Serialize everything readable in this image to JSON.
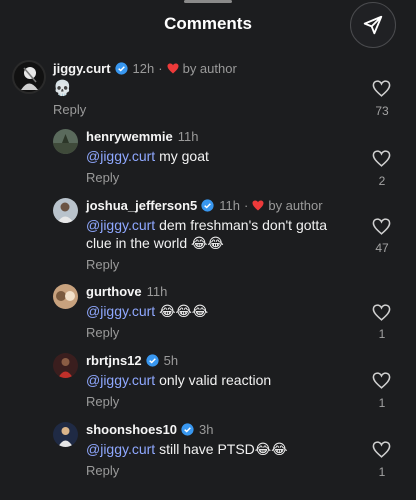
{
  "header": {
    "title": "Comments"
  },
  "comments": [
    {
      "username": "jiggy.curt",
      "verified": true,
      "time": "12h",
      "liked_by_author": true,
      "by_author": "by author",
      "mention": "",
      "text": "💀",
      "text2": "",
      "reply_label": "Reply",
      "likes": "73"
    },
    {
      "username": "henrywemmie",
      "verified": false,
      "time": "11h",
      "liked_by_author": false,
      "by_author": "",
      "mention": "@jiggy.curt",
      "text": " my goat",
      "text2": "",
      "reply_label": "Reply",
      "likes": "2"
    },
    {
      "username": "joshua_jefferson5",
      "verified": true,
      "time": "11h",
      "liked_by_author": true,
      "by_author": "by author",
      "mention": "@jiggy.curt",
      "text": " dem freshman's don't gotta",
      "text2": "clue in the world 😂😂",
      "reply_label": "Reply",
      "likes": "47"
    },
    {
      "username": "gurthove",
      "verified": false,
      "time": "11h",
      "liked_by_author": false,
      "by_author": "",
      "mention": "@jiggy.curt",
      "text": " 😂😂😂",
      "text2": "",
      "reply_label": "Reply",
      "likes": "1"
    },
    {
      "username": "rbrtjns12",
      "verified": true,
      "time": "5h",
      "liked_by_author": false,
      "by_author": "",
      "mention": "@jiggy.curt",
      "text": " only valid reaction",
      "text2": "",
      "reply_label": "Reply",
      "likes": "1"
    },
    {
      "username": "shoonshoes10",
      "verified": true,
      "time": "3h",
      "liked_by_author": false,
      "by_author": "",
      "mention": "@jiggy.curt",
      "text": " still have PTSD😂😂",
      "text2": "",
      "reply_label": "Reply",
      "likes": "1"
    }
  ],
  "colors": {
    "mention": "#8fa8ff",
    "verified": "#3897f0",
    "heart": "#ed3a3a"
  },
  "icons": [
    "send-icon",
    "verified-badge-icon",
    "heart-outline-icon",
    "red-heart-icon"
  ]
}
